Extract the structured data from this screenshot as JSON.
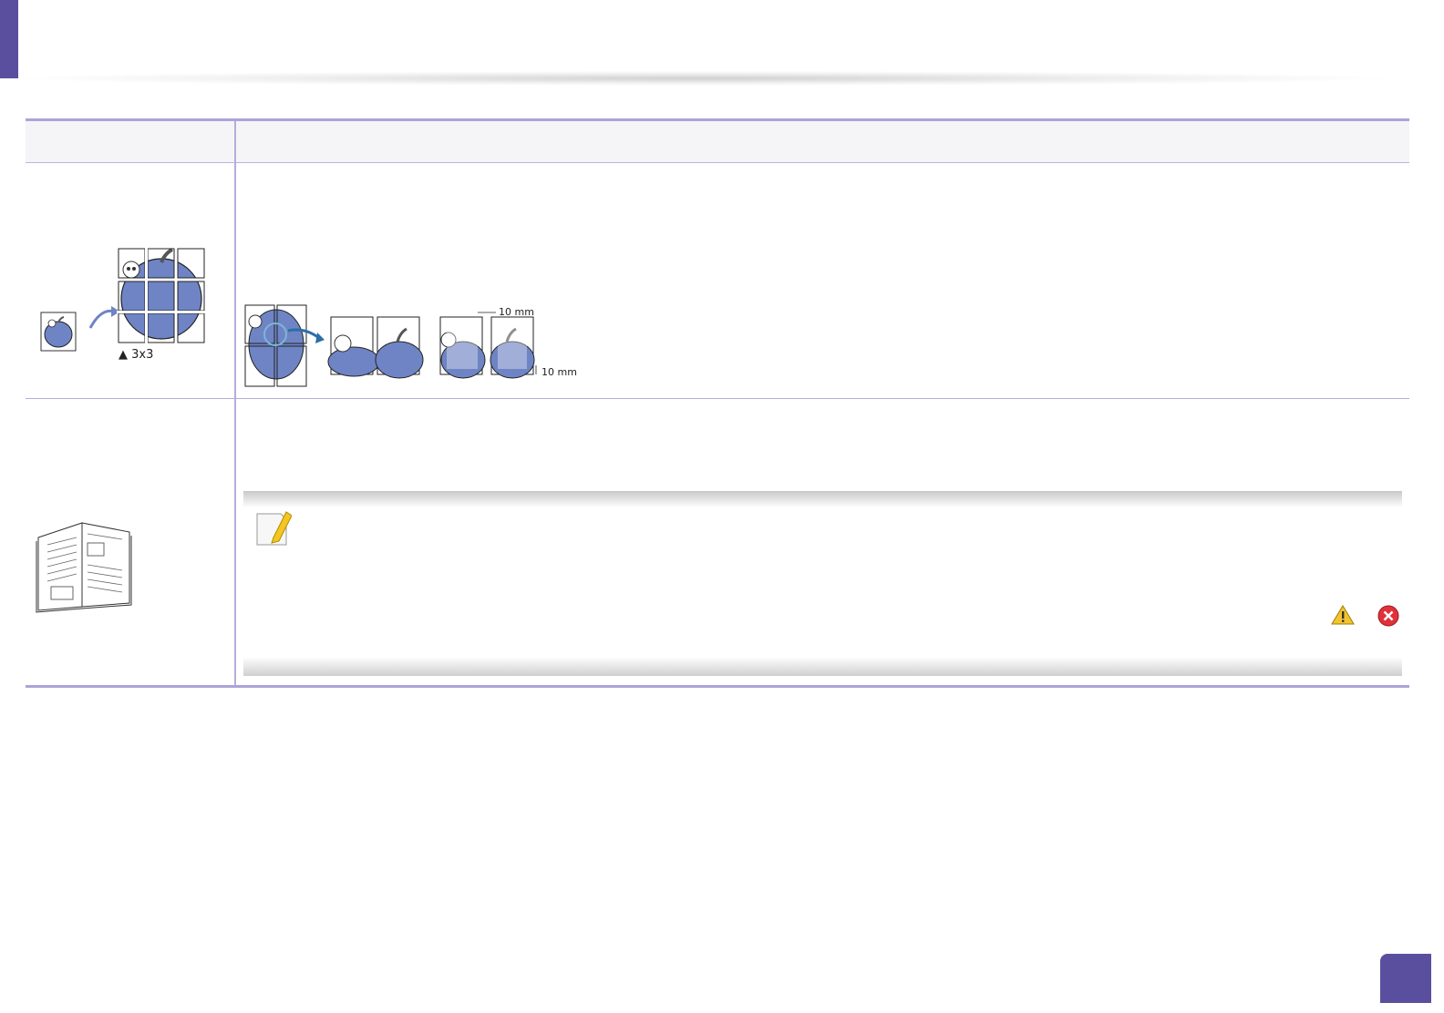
{
  "poster": {
    "grid_caption": "▲ 3x3",
    "overlap_horizontal": "10 mm",
    "overlap_vertical": "10 mm"
  },
  "colors": {
    "accent": "#5a4f9e",
    "rule": "#aaa4d8",
    "apple": "#6f84c4"
  },
  "icons": [
    "note-pencil-icon",
    "warning-icon",
    "error-icon",
    "open-book-icon"
  ]
}
